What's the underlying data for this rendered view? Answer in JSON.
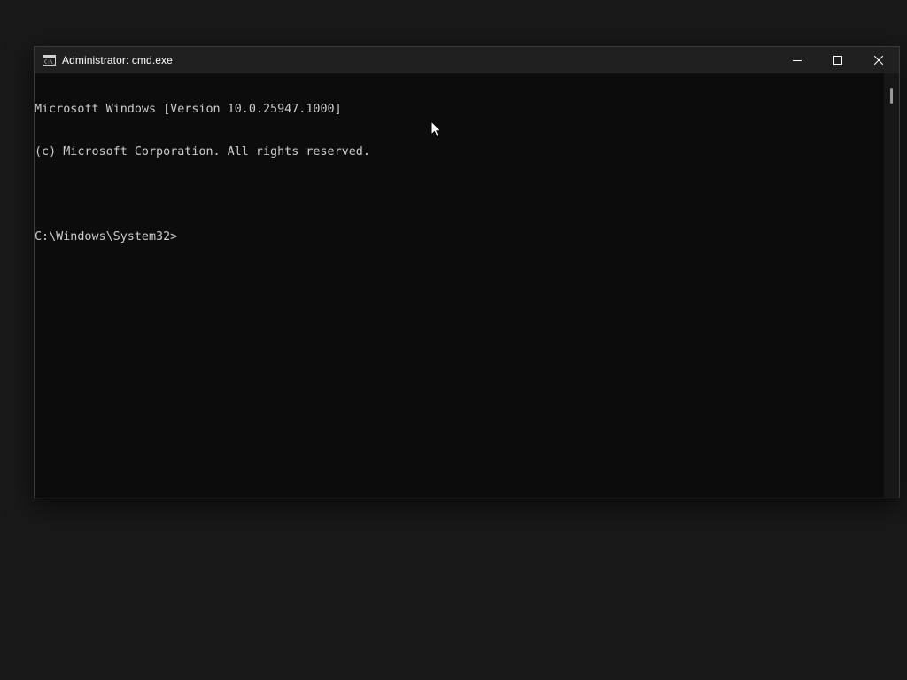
{
  "window": {
    "title": "Administrator: cmd.exe",
    "app_icon": "cmd-icon"
  },
  "caption_buttons": {
    "minimize": "minimize-icon",
    "maximize": "maximize-icon",
    "close": "close-icon"
  },
  "console": {
    "lines": [
      "Microsoft Windows [Version 10.0.25947.1000]",
      "(c) Microsoft Corporation. All rights reserved.",
      "",
      "C:\\Windows\\System32>"
    ]
  },
  "colors": {
    "console_bg": "#0c0c0c",
    "console_text": "#cccccc",
    "titlebar_bg": "#202020",
    "desktop_bg": "#191919"
  }
}
